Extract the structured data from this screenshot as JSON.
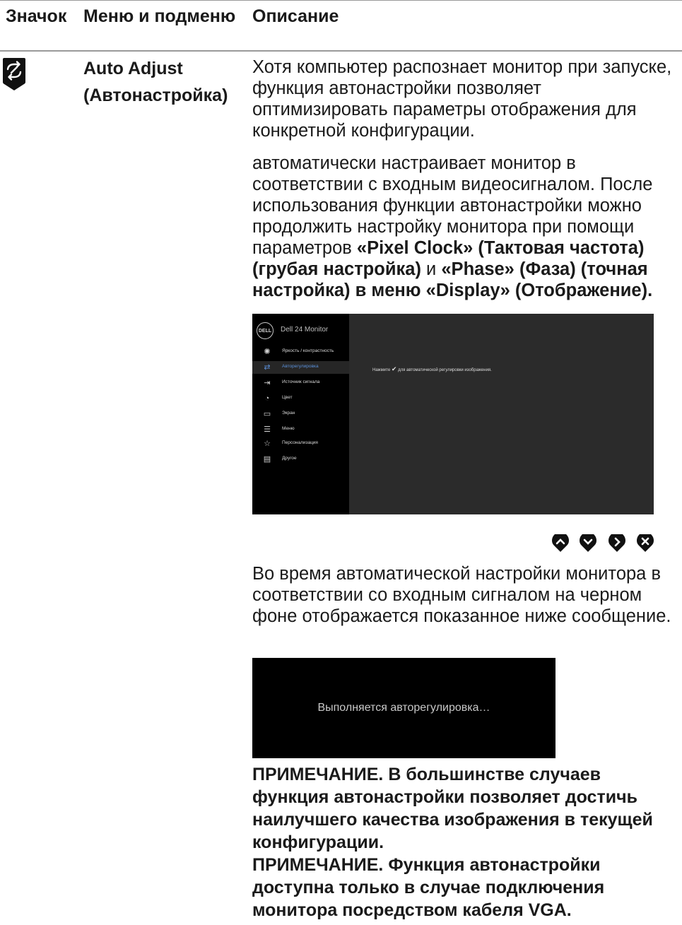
{
  "table": {
    "headers": {
      "icon": "Значок",
      "menu": "Меню и подменю",
      "description": "Описание"
    },
    "row": {
      "icon_name": "auto-adjust-icon",
      "menu_name_en": "Auto Adjust",
      "menu_name_ru": "(Автонастройка)",
      "para1": "Хотя компьютер распознает монитор при запуске, функция автонастройки позволяет оптимизировать параметры отображения для конкретной конфигурации.",
      "para2_plain": " автоматически настраивает монитор в соответствии с входным видеосигналом. После использования функции автонастройки можно продолжить настройку монитора при помощи параметров ",
      "para2_bold1": "«Pixel Clock» (Тактовая частота) (грубая настройка)",
      "para2_mid": " и ",
      "para2_bold2": "«Phase» (Фаза) (точная настройка) в меню «Display» (Отображение).",
      "para3": "Во время автоматической настройки монитора в соответствии со входным сигналом на черном фоне отображается показанное ниже сообщение.",
      "note1": "ПРИМЕЧАНИЕ. В большинстве случаев функция автонастройки позволяет достичь наилучшего качества изображения в текущей конфигурации.",
      "note2": "ПРИМЕЧАНИЕ. Функция автонастройки доступна только в случае подключения монитора посредством кабеля VGA."
    }
  },
  "osd": {
    "logo": "DELL",
    "model": "Dell 24 Monitor",
    "accent_color": "#5a8fd8",
    "items": [
      {
        "label": "Яркость / контрастность",
        "icon": "brightness-icon"
      },
      {
        "label": "Авторегулировка",
        "icon": "auto-adjust-icon",
        "active": true
      },
      {
        "label": "Источник сигнала",
        "icon": "input-source-icon"
      },
      {
        "label": "Цвет",
        "icon": "color-palette-icon"
      },
      {
        "label": "Экран",
        "icon": "display-icon"
      },
      {
        "label": "Меню",
        "icon": "menu-icon"
      },
      {
        "label": "Персонализация",
        "icon": "star-icon"
      },
      {
        "label": "Другое",
        "icon": "others-icon"
      }
    ],
    "message_pre": "Нажмите",
    "message_post": "для автоматической регулировки изображения."
  },
  "nav_buttons": [
    "up-icon",
    "down-icon",
    "right-icon",
    "close-icon"
  ],
  "auto_adjust_message": "Выполняется авторегулировка…"
}
